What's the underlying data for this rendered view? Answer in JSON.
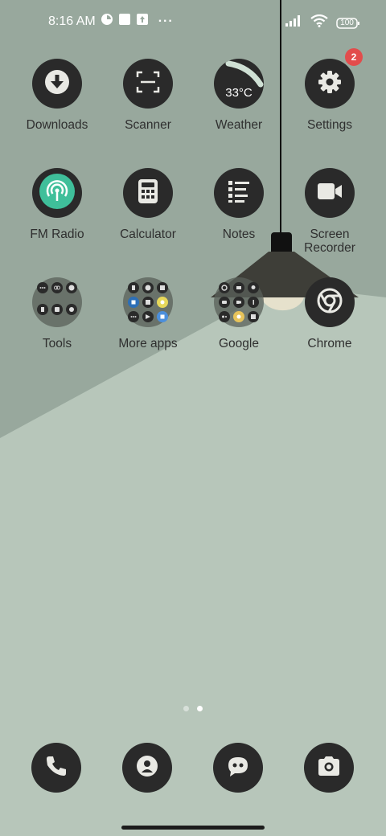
{
  "status_bar": {
    "time": "8:16 AM",
    "overflow": "···",
    "battery": "100",
    "icons": [
      "data-saver-icon",
      "notification-square-icon",
      "upload-icon",
      "signal-icon",
      "wifi-icon",
      "battery-icon"
    ]
  },
  "apps": [
    {
      "label": "Downloads",
      "icon": "download-icon"
    },
    {
      "label": "Scanner",
      "icon": "scanner-icon"
    },
    {
      "label": "Weather",
      "icon": "weather-icon",
      "value": "33°C"
    },
    {
      "label": "Settings",
      "icon": "gear-icon",
      "badge": "2"
    },
    {
      "label": "FM Radio",
      "icon": "radio-icon"
    },
    {
      "label": "Calculator",
      "icon": "calculator-icon"
    },
    {
      "label": "Notes",
      "icon": "notes-icon"
    },
    {
      "label": "Screen Recorder",
      "icon": "video-camera-icon"
    },
    {
      "label": "Tools",
      "icon": "folder-icon"
    },
    {
      "label": "More apps",
      "icon": "folder-icon"
    },
    {
      "label": "Google",
      "icon": "folder-icon"
    },
    {
      "label": "Chrome",
      "icon": "chrome-icon"
    }
  ],
  "page_indicator": {
    "count": 2,
    "active": 2
  },
  "dock": [
    {
      "icon": "phone-icon"
    },
    {
      "icon": "contacts-icon"
    },
    {
      "icon": "messages-icon"
    },
    {
      "icon": "camera-icon"
    }
  ],
  "colors": {
    "wallpaper_dark": "#98a89d",
    "wallpaper_light": "#b7c6ba",
    "icon_bg": "#2a2a2a",
    "badge": "#e24c4c",
    "radio_accent": "#3fbf9a"
  }
}
